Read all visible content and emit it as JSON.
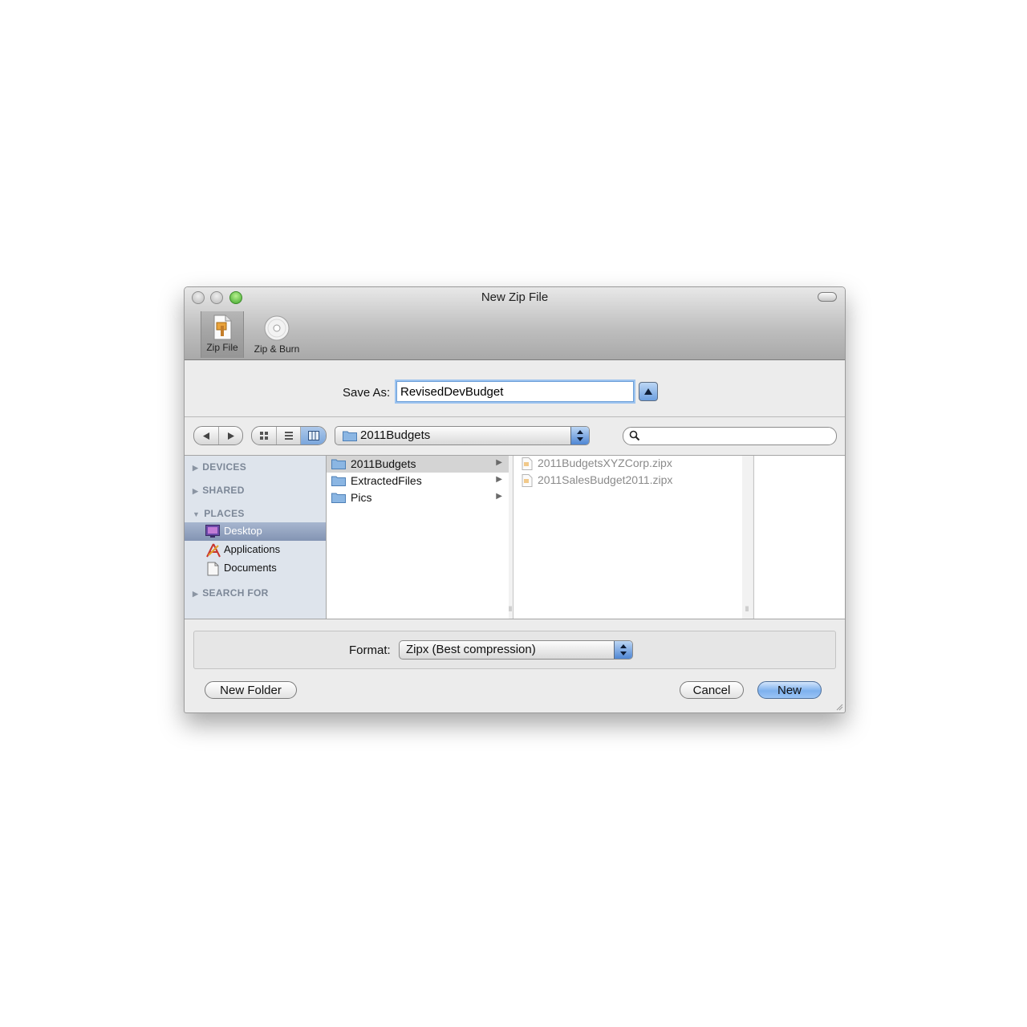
{
  "window": {
    "title": "New Zip File"
  },
  "toolbar": {
    "items": [
      {
        "label": "Zip File",
        "icon": "zip-file-icon"
      },
      {
        "label": "Zip & Burn",
        "icon": "cd-disc-icon"
      }
    ]
  },
  "save_as": {
    "label": "Save As:",
    "value": "RevisedDevBudget"
  },
  "location": {
    "current_folder": "2011Budgets"
  },
  "search": {
    "placeholder": ""
  },
  "sidebar": {
    "sections": [
      {
        "label": "DEVICES",
        "expanded": false
      },
      {
        "label": "SHARED",
        "expanded": false
      },
      {
        "label": "PLACES",
        "expanded": true
      },
      {
        "label": "SEARCH FOR",
        "expanded": false
      }
    ],
    "places": [
      {
        "label": "Desktop",
        "icon": "desktop-icon",
        "selected": true
      },
      {
        "label": "Applications",
        "icon": "applications-icon",
        "selected": false
      },
      {
        "label": "Documents",
        "icon": "documents-icon",
        "selected": false
      }
    ]
  },
  "browser": {
    "column1": [
      {
        "name": "2011Budgets",
        "selected": true
      },
      {
        "name": "ExtractedFiles",
        "selected": false
      },
      {
        "name": "Pics",
        "selected": false
      }
    ],
    "column2": [
      {
        "name": "2011BudgetsXYZCorp.zipx"
      },
      {
        "name": "2011SalesBudget2011.zipx"
      }
    ]
  },
  "format": {
    "label": "Format:",
    "value": "Zipx (Best compression)"
  },
  "buttons": {
    "new_folder": "New Folder",
    "cancel": "Cancel",
    "new": "New"
  },
  "colors": {
    "accent": "#7eb1ee",
    "selection": "#8394b3",
    "sidebar_bg": "#dee4ec"
  }
}
